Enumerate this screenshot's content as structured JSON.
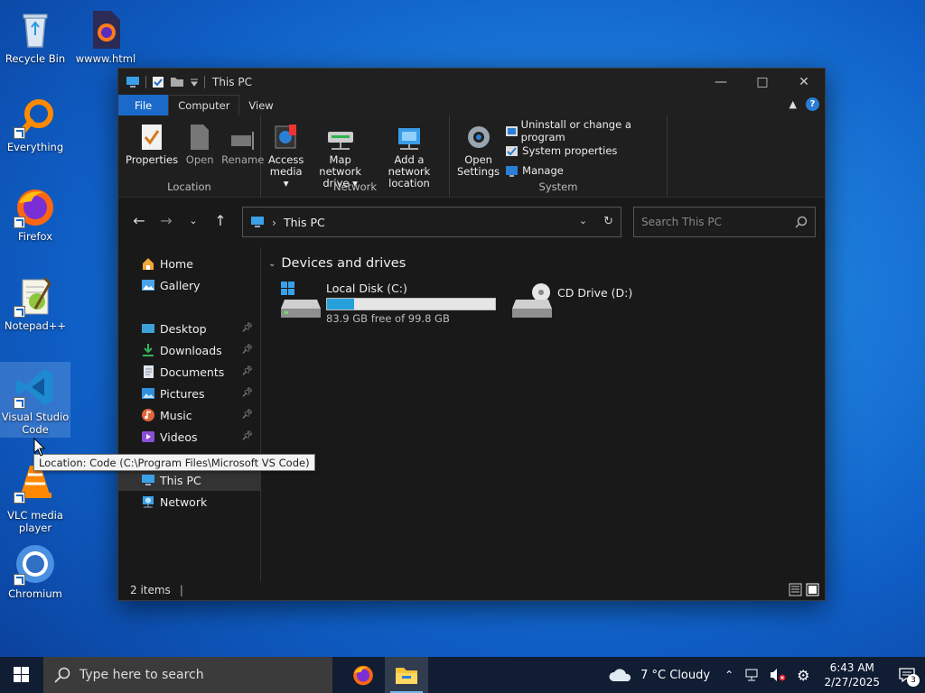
{
  "desktop": {
    "icons": [
      {
        "label": "Recycle Bin"
      },
      {
        "label": "wwww.html"
      },
      {
        "label": "Everything"
      },
      {
        "label": "Firefox"
      },
      {
        "label": "Notepad++"
      },
      {
        "label": "Visual Studio Code"
      },
      {
        "label": "VLC media player"
      },
      {
        "label": "Chromium"
      }
    ],
    "tooltip": "Location: Code (C:\\Program Files\\Microsoft VS Code)"
  },
  "window": {
    "title": "This PC",
    "tabs": {
      "file": "File",
      "computer": "Computer",
      "view": "View"
    },
    "ribbon": {
      "location": {
        "name": "Location",
        "properties": "Properties",
        "open": "Open",
        "rename": "Rename"
      },
      "network": {
        "name": "Network",
        "access_media": [
          "Access",
          "media"
        ],
        "map_drive": [
          "Map network",
          "drive"
        ],
        "add_location": [
          "Add a network",
          "location"
        ]
      },
      "system": {
        "name": "System",
        "open_settings": [
          "Open",
          "Settings"
        ],
        "uninstall": "Uninstall or change a program",
        "system_properties": "System properties",
        "manage": "Manage"
      }
    },
    "address": {
      "path": "This PC",
      "search_placeholder": "Search This PC"
    },
    "nav": {
      "home": "Home",
      "gallery": "Gallery",
      "desktop": "Desktop",
      "downloads": "Downloads",
      "documents": "Documents",
      "pictures": "Pictures",
      "music": "Music",
      "videos": "Videos",
      "this_pc": "This PC",
      "network": "Network"
    },
    "content": {
      "section": "Devices and drives",
      "drives": [
        {
          "name": "Local Disk (C:)",
          "free": "83.9 GB free of 99.8 GB",
          "used_fraction": 0.16
        },
        {
          "name": "CD Drive (D:)"
        }
      ]
    },
    "status": {
      "items": "2 items"
    }
  },
  "taskbar": {
    "search_placeholder": "Type here to search",
    "weather": "7 °C  Cloudy",
    "time": "6:43 AM",
    "date": "2/27/2025",
    "notifications": "3"
  },
  "colors": {
    "accent": "#1b6ac9",
    "progress": "#26a0da",
    "taskbar": "#101d33"
  }
}
